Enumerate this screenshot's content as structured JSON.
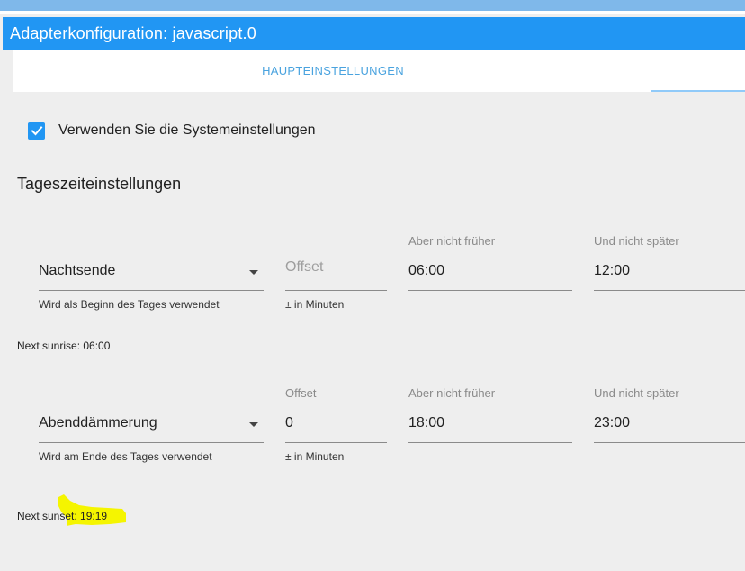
{
  "header": {
    "title": "Adapterkonfiguration: javascript.0"
  },
  "tabs": [
    {
      "label": "HAUPTEINSTELLUNGEN"
    }
  ],
  "settings": {
    "use_system_label": "Verwenden Sie die Systemeinstellungen",
    "use_system_checked": true,
    "section_title": "Tageszeiteinstellungen"
  },
  "start": {
    "event": "Nachtsende",
    "event_helper": "Wird als Beginn des Tages verwendet",
    "offset_placeholder": "Offset",
    "offset_value": "",
    "offset_helper": "± in Minuten",
    "not_earlier_label": "Aber nicht früher",
    "not_earlier": "06:00",
    "not_later_label": "Und nicht später",
    "not_later": "12:00",
    "next_text": "Next sunrise: 06:00"
  },
  "end": {
    "event": "Abenddämmerung",
    "event_helper": "Wird am Ende des Tages verwendet",
    "offset_label": "Offset",
    "offset_value": "0",
    "offset_helper": "± in Minuten",
    "not_earlier_label": "Aber nicht früher",
    "not_earlier": "18:00",
    "not_later_label": "Und nicht später",
    "not_later": "23:00",
    "next_text": "Next sunset: 19:19"
  },
  "colors": {
    "accent": "#2196f3",
    "tab_text": "#4aa3df",
    "highlight": "#f5f500"
  },
  "icons": {
    "checkbox": "check-icon",
    "dropdown": "triangle-down-icon"
  }
}
